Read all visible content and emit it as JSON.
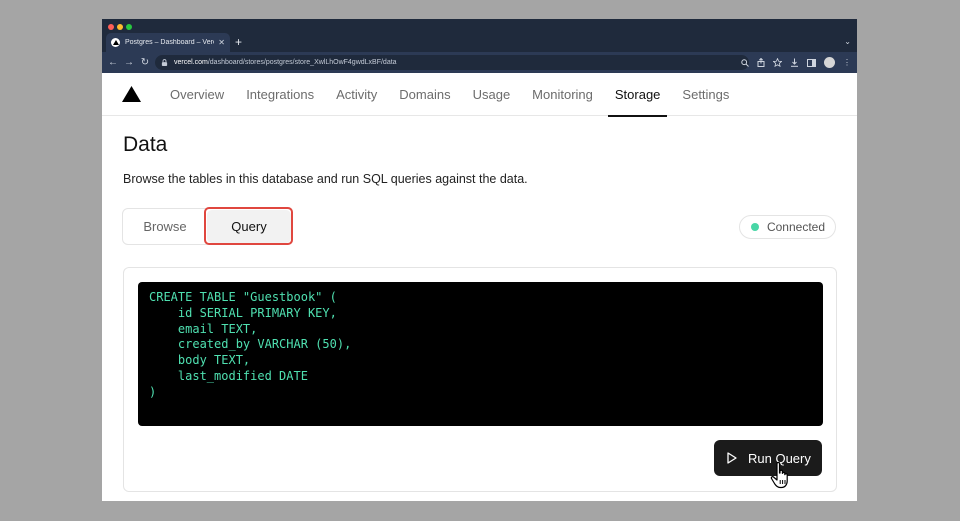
{
  "browser": {
    "tab_title": "Postgres – Dashboard – Vercel",
    "new_tab": "+",
    "tab_close": "✕",
    "tabs_menu": "⌄",
    "url_domain": "vercel.com",
    "url_path": "/dashboard/stores/postgres/store_XwlLhOwF4gwdLxBF/data",
    "traffic_colors": [
      "#ff5f57",
      "#febc2e",
      "#28c840"
    ]
  },
  "nav": {
    "items": [
      {
        "label": "Overview"
      },
      {
        "label": "Integrations"
      },
      {
        "label": "Activity"
      },
      {
        "label": "Domains"
      },
      {
        "label": "Usage"
      },
      {
        "label": "Monitoring"
      },
      {
        "label": "Storage",
        "active": true
      },
      {
        "label": "Settings"
      }
    ]
  },
  "page": {
    "title": "Data",
    "description": "Browse the tables in this database and run SQL queries against the data."
  },
  "tabs": {
    "browse": "Browse",
    "query": "Query",
    "selected": "query"
  },
  "status": {
    "label": "Connected",
    "color": "#48d6a6"
  },
  "editor": {
    "lines": [
      "CREATE TABLE \"Guestbook\" (",
      "    id SERIAL PRIMARY KEY,",
      "    email TEXT,",
      "    created_by VARCHAR (50),",
      "    body TEXT,",
      "    last_modified DATE",
      ")"
    ],
    "text_color": "#4fe0b0"
  },
  "run_button": {
    "label": "Run Query",
    "icon": "play-icon"
  },
  "accent": {
    "highlight": "#e0473f"
  }
}
